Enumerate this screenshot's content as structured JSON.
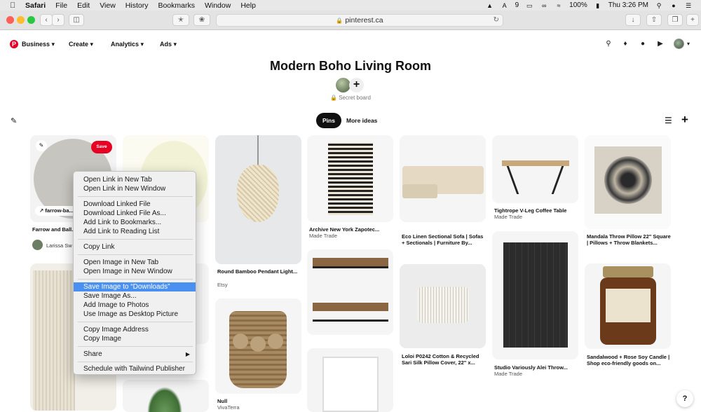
{
  "menubar": {
    "apple": "",
    "app": "Safari",
    "items": [
      "File",
      "Edit",
      "View",
      "History",
      "Bookmarks",
      "Window",
      "Help"
    ],
    "status": {
      "adobe_count": "9",
      "battery": "100%",
      "clock": "Thu 3:26 PM"
    }
  },
  "browser": {
    "url": "pinterest.ca"
  },
  "nav": {
    "logo": "P",
    "items": [
      "Business",
      "Create",
      "Analytics",
      "Ads"
    ]
  },
  "board": {
    "title": "Modern Boho Living Room",
    "privacy": "Secret board",
    "tabs": [
      "Pins",
      "More ideas"
    ]
  },
  "pins": [
    {
      "title": "Farrow and Ball... No...",
      "user": "Larissa Sw",
      "link": "farrow-ba...",
      "save": "Save"
    },
    {
      "title": "Round Bamboo Pendant Light...",
      "sub": "Etsy"
    },
    {
      "title": "Archive New York Zapotec...",
      "sub": "Made Trade"
    },
    {
      "title": "Eco Linen Sectional Sofa | Sofas + Sectionals | Furniture By...",
      "sub": ""
    },
    {
      "title": "Tightrope V-Leg Coffee Table",
      "sub": "Made Trade"
    },
    {
      "title": "Mandala Throw Pillow 22\" Square | Pillows + Throw Blankets...",
      "sub": ""
    },
    {
      "title": "Null",
      "sub": "VivaTerra"
    },
    {
      "title": "Loloi P0242 Cotton & Recycled Sari Silk Pillow Cover, 22\" x...",
      "sub": ""
    },
    {
      "title": "Studio Variously Alei Throw...",
      "sub": "Made Trade"
    },
    {
      "title": "Sandalwood + Rose Soy Candle | Shop eco-friendly goods on...",
      "sub": ""
    }
  ],
  "context_menu": [
    "Open Link in New Tab",
    "Open Link in New Window",
    "Download Linked File",
    "Download Linked File As...",
    "Add Link to Bookmarks...",
    "Add Link to Reading List",
    "Copy Link",
    "Open Image in New Tab",
    "Open Image in New Window",
    "Save Image to “Downloads”",
    "Save Image As...",
    "Add Image to Photos",
    "Use Image as Desktop Picture",
    "Copy Image Address",
    "Copy Image",
    "Share",
    "Schedule with Tailwind Publisher"
  ],
  "help": "?"
}
